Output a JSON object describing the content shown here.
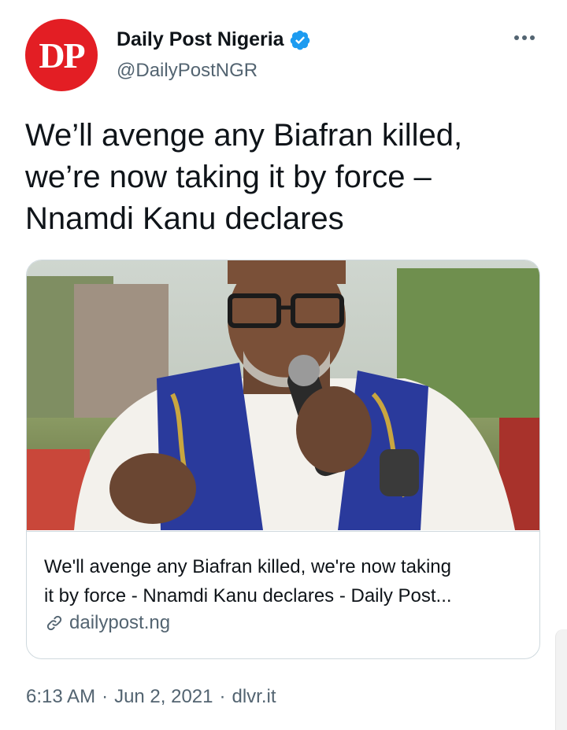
{
  "author": {
    "display_name": "Daily Post Nigeria",
    "handle": "@DailyPostNGR",
    "avatar_text": "DP",
    "verified": true
  },
  "tweet": {
    "text_line1": "We’ll avenge any Biafran killed,",
    "text_line2": "we’re now taking it by force –",
    "text_line3": "Nnamdi Kanu declares"
  },
  "card": {
    "title_line1": "We'll avenge any Biafran killed, we're now taking",
    "title_line2": "it by force - Nnamdi Kanu declares - Daily Post...",
    "domain": "dailypost.ng"
  },
  "meta": {
    "time": "6:13 AM",
    "date": "Jun 2, 2021",
    "source": "dlvr.it",
    "separator": "·"
  },
  "icons": {
    "verified": "verified-badge-icon",
    "more": "more-options-icon",
    "link": "link-icon"
  },
  "colors": {
    "avatar_bg": "#e31e24",
    "verified_blue": "#1d9bf0",
    "secondary_text": "#536471",
    "border": "#cfd9de"
  }
}
